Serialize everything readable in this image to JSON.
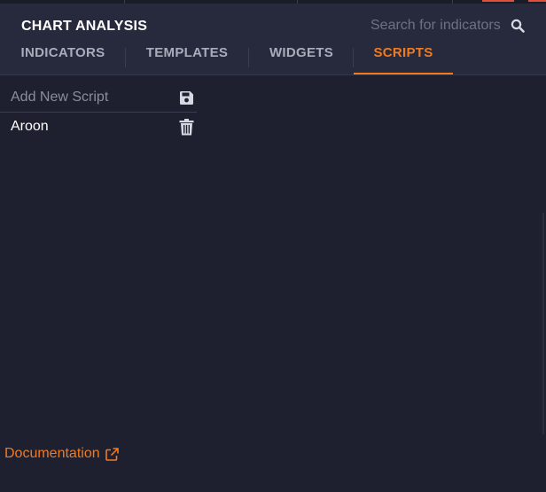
{
  "panel": {
    "title": "CHART ANALYSIS",
    "search_placeholder": "Search for indicators"
  },
  "tabs": [
    {
      "label": "INDICATORS",
      "active": false
    },
    {
      "label": "TEMPLATES",
      "active": false
    },
    {
      "label": "WIDGETS",
      "active": false
    },
    {
      "label": "SCRIPTS",
      "active": true
    }
  ],
  "scripts": {
    "new_script_placeholder": "Add New Script",
    "items": [
      {
        "name": "Aroon"
      }
    ]
  },
  "footer": {
    "documentation_label": "Documentation"
  },
  "colors": {
    "accent": "#f07a20",
    "background": "#1e2030",
    "header": "#272a3c"
  },
  "icons": {
    "search": "search-icon",
    "save": "save-icon",
    "delete": "trash-icon",
    "external": "external-link-icon"
  }
}
